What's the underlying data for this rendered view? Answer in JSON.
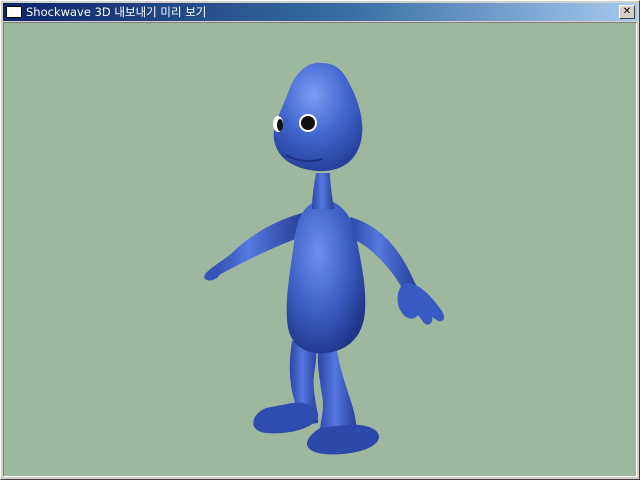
{
  "window": {
    "title": "Shockwave 3D 내보내기 미리 보기",
    "close_glyph": "✕"
  },
  "viewport": {
    "background_color": "#9eb89f",
    "model_color": "#3d5fc4",
    "model_description_icon": "blue-alien-character-model"
  }
}
